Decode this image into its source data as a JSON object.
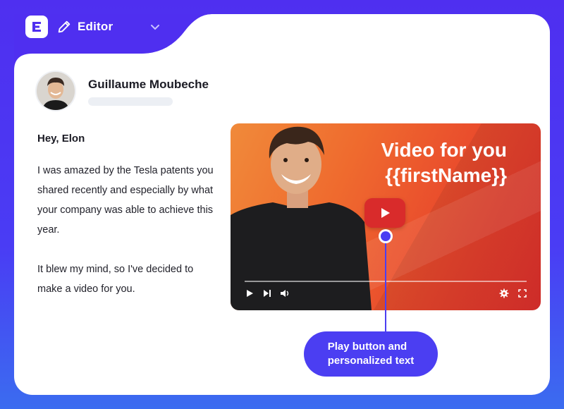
{
  "header": {
    "title": "Editor",
    "logo_icon": "logo-icon",
    "edit_icon": "pencil-icon",
    "dropdown_icon": "chevron-down-icon"
  },
  "sender": {
    "name": "Guillaume Moubeche"
  },
  "email": {
    "greeting": "Hey, Elon",
    "paragraph1": "I was amazed by the Tesla patents you shared recently and especially by what your company was able to achieve this year.",
    "paragraph2": "It blew my mind, so I've decided to make a video for you."
  },
  "video": {
    "title_line1": "Video for you",
    "title_line2": "{{firstName}}",
    "controls": [
      "play-icon",
      "next-icon",
      "volume-icon",
      "settings-icon",
      "fullscreen-icon"
    ],
    "colors": {
      "gradient_start": "#f08a3a",
      "gradient_end": "#df2f2c",
      "play_button": "#d92b2b"
    }
  },
  "callout": {
    "text": "Play button and\npersonalized text",
    "color": "#4b3ef2"
  }
}
